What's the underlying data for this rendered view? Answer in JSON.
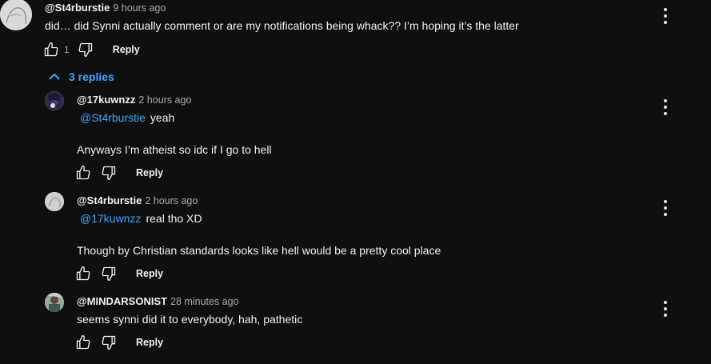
{
  "top_comment": {
    "author": "@St4rburstie",
    "time": "9 hours ago",
    "text": "did… did Synni actually comment or are my notifications being whack?? I’m hoping it’s the latter",
    "likes": "1",
    "reply_label": "Reply"
  },
  "replies_toggle": {
    "label": "3 replies"
  },
  "replies": [
    {
      "author": "@17kuwnzz",
      "time": "2 hours ago",
      "mention": "@St4rburstie",
      "line1": "yeah",
      "line2": "Anyways I’m atheist so idc if I go to hell",
      "reply_label": "Reply"
    },
    {
      "author": "@St4rburstie",
      "time": "2 hours ago",
      "mention": "@17kuwnzz",
      "line1": "real tho XD",
      "line2": "Though by Christian standards looks like hell would be a pretty cool place",
      "reply_label": "Reply"
    },
    {
      "author": "@MINDARSONIST",
      "time": "28 minutes ago",
      "text": "seems synni did it to everybody, hah, pathetic",
      "reply_label": "Reply"
    }
  ],
  "colors": {
    "background": "#0f0f0f",
    "text": "#f1f1f1",
    "secondary": "#aaaaaa",
    "link": "#3ea6ff"
  },
  "icons": [
    "like-icon",
    "dislike-icon",
    "more-vert-icon",
    "chevron-up-icon"
  ]
}
